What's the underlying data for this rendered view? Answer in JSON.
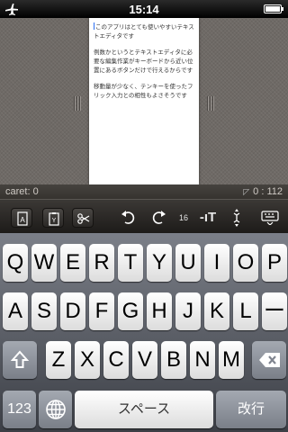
{
  "status": {
    "time": "15:14"
  },
  "document": {
    "paragraphs": [
      "このアプリはとても使いやすいテキストエディタです",
      "例数かというとテキストエディタに必要な編集作業がキーボードから近い位置にあるボタンだけで行えるからです",
      "移動量が少なく、テンキーを使ったフリック入力との相性もよさそうです"
    ]
  },
  "info": {
    "caret_label": "caret: 0",
    "position": "0 : 112"
  },
  "toolbar": {
    "font_size": "16",
    "text_size_label": "-ıT"
  },
  "keyboard": {
    "row1": [
      "Q",
      "W",
      "E",
      "R",
      "T",
      "Y",
      "U",
      "I",
      "O",
      "P"
    ],
    "row2": [
      "A",
      "S",
      "D",
      "F",
      "G",
      "H",
      "J",
      "K",
      "L",
      "ー"
    ],
    "row3": [
      "Z",
      "X",
      "C",
      "V",
      "B",
      "N",
      "M"
    ],
    "numbers_label": "123",
    "space_label": "スペース",
    "return_label": "改行"
  }
}
